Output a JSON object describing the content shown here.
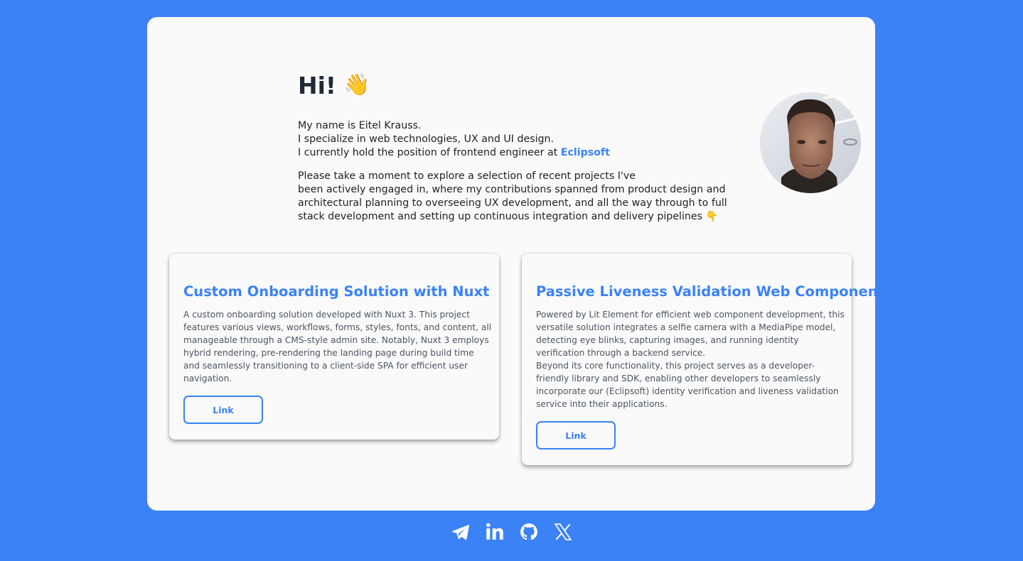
{
  "intro": {
    "greeting": "Hi!",
    "greeting_emoji": "👋",
    "bio_line1": "My name is Eitel Krauss.",
    "bio_line2": "I specialize in web technologies, UX and UI design.",
    "bio_line3_prefix": "I currently hold the position of frontend engineer at ",
    "company_link": "Eclipsoft",
    "projects_line1": "Please take a moment to explore a selection of recent projects I've",
    "projects_line2": "been actively engaged in, where my contributions spanned from product design and",
    "projects_line3": "architectural planning to overseeing UX development, and all the way through to full",
    "projects_line4": "stack development and setting up continuous integration and delivery pipelines 👇"
  },
  "projects": [
    {
      "title": "Custom Onboarding Solution with Nuxt",
      "description_lines": [
        "A custom onboarding solution developed with Nuxt 3. This project",
        "features various views, workflows, forms, styles, fonts, and content, all",
        "manageable through a CMS-style admin site. Notably, Nuxt 3 employs",
        "hybrid rendering, pre-rendering the landing page during build time",
        "and seamlessly transitioning to a client-side SPA for efficient user",
        "navigation."
      ],
      "link_label": "Link"
    },
    {
      "title": "Passive Liveness Validation Web Component",
      "description_lines": [
        "Powered by Lit Element for efficient web component development, this",
        "versatile solution integrates a selfie camera with a MediaPipe model,",
        "detecting eye blinks, capturing images, and running identity",
        "verification through a backend service.",
        "Beyond its core functionality, this project serves as a developer-",
        "friendly library and SDK, enabling other developers to seamlessly",
        "incorporate our (Eclipsoft) identity verification and liveness validation",
        "service into their applications."
      ],
      "link_label": "Link"
    }
  ],
  "socials": [
    {
      "icon": "telegram-icon"
    },
    {
      "icon": "linkedin-icon"
    },
    {
      "icon": "github-icon"
    },
    {
      "icon": "x-icon"
    }
  ],
  "colors": {
    "background": "#3b82f6",
    "accent": "#3b82f6",
    "card": "#fafafa"
  }
}
